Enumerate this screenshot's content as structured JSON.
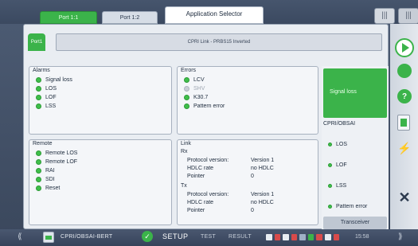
{
  "top_tabs": {
    "port1": "Port 1:1",
    "port2": "Port 1:2",
    "app_selector": "Application Selector",
    "btn_a": "|||",
    "btn_b": "|||"
  },
  "port_chip": "Port1",
  "cpri_link": "CPRI Link - PRBS15 Inverted",
  "alarms": {
    "title": "Alarms",
    "items": [
      "Signal loss",
      "LOS",
      "LOF",
      "LSS"
    ]
  },
  "errors": {
    "title": "Errors",
    "items": [
      "LCV",
      "SHV",
      "K30.7",
      "Pattern error"
    ]
  },
  "remote": {
    "title": "Remote",
    "items": [
      "Remote LOS",
      "Remote LOF",
      "RAI",
      "SDI",
      "Reset"
    ]
  },
  "link": {
    "title": "Link",
    "rx_label": "Rx",
    "tx_label": "Tx",
    "rx": [
      {
        "key": "Protocol version:",
        "value": "Version 1"
      },
      {
        "key": "HDLC rate",
        "value": "no HDLC"
      },
      {
        "key": "Pointer",
        "value": "0"
      }
    ],
    "tx": [
      {
        "key": "Protocol version:",
        "value": "Version 1"
      },
      {
        "key": "HDLC rate",
        "value": "no HDLC"
      },
      {
        "key": "Pointer",
        "value": "0"
      }
    ]
  },
  "summary": {
    "signal_loss": "Signal loss",
    "section_title": "CPRI/OBSAI",
    "items": [
      "LOS",
      "LOF",
      "LSS",
      "Pattern error"
    ],
    "transceiver": "Transceiver"
  },
  "sidebar": {
    "help": "?",
    "close": "✕",
    "lightning": "⚡"
  },
  "bottom": {
    "left_chev": "⟪",
    "right_chev": "⟫",
    "app_name": "CPRI/OBSAI-BERT",
    "check": "✓",
    "setup": "SETUP",
    "test": "TEST",
    "result": "RESULT",
    "time": "15:58"
  },
  "colors": {
    "accent_green": "#3bb34a",
    "frame": "#4d5c74",
    "panel": "#e9edf2"
  }
}
